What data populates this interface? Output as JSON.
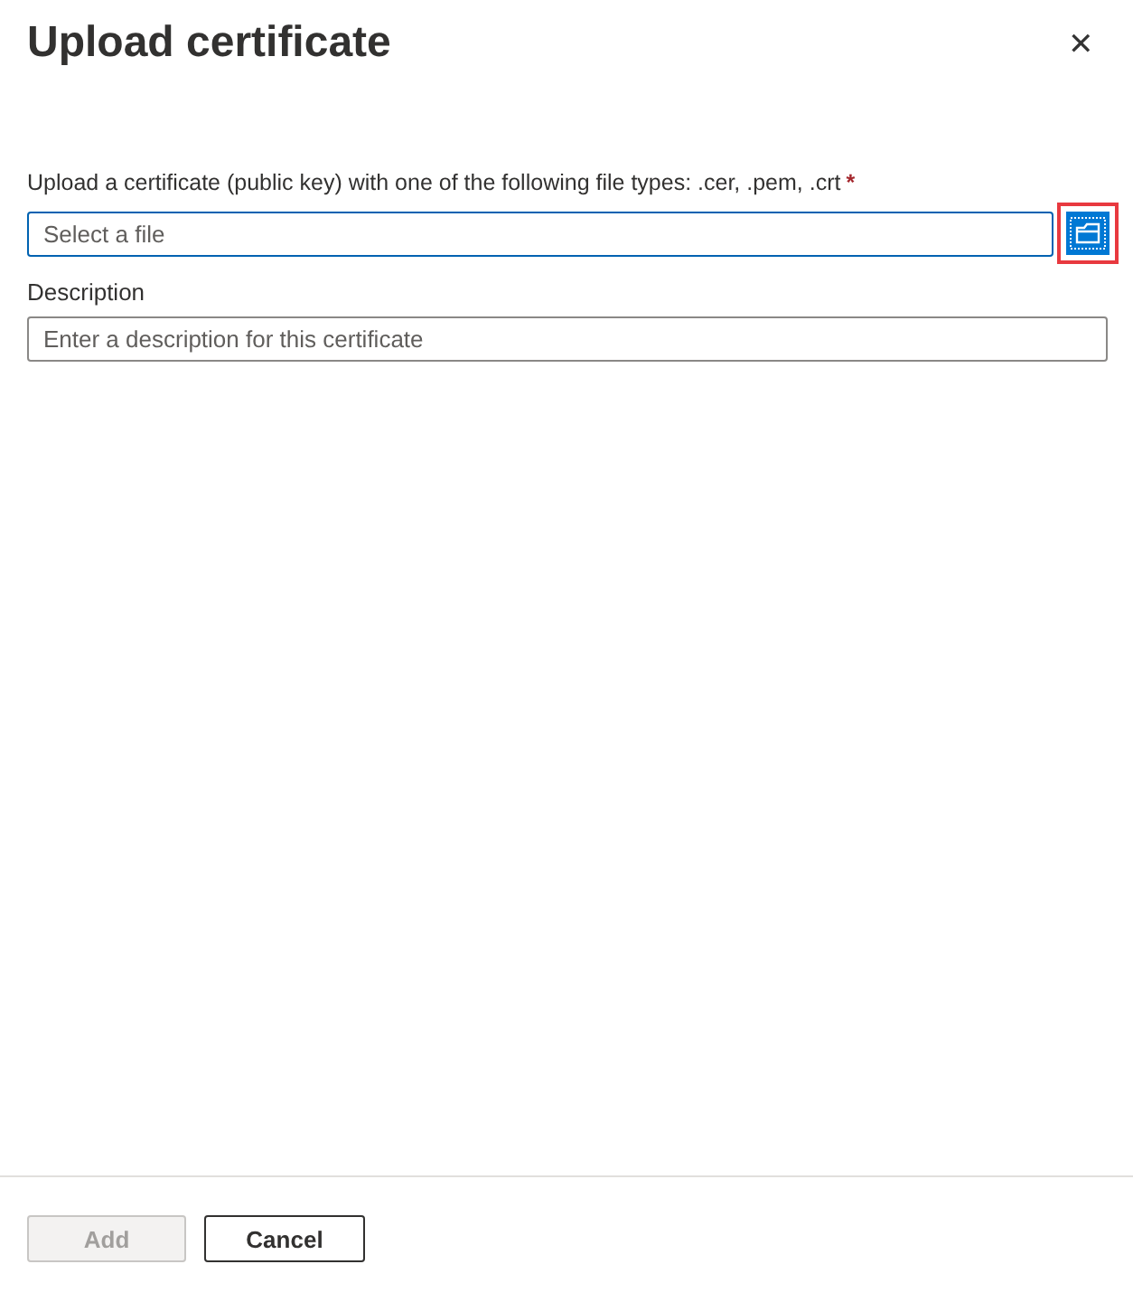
{
  "panel": {
    "title": "Upload certificate",
    "close": "✕"
  },
  "file_field": {
    "label": "Upload a certificate (public key) with one of the following file types: .cer, .pem, .crt",
    "required_mark": "*",
    "placeholder": "Select a file",
    "browse_highlighted": true
  },
  "description_field": {
    "label": "Description",
    "placeholder": "Enter a description for this certificate"
  },
  "buttons": [
    {
      "label": "Add",
      "kind": "primary",
      "disabled": true
    },
    {
      "label": "Cancel",
      "kind": "secondary",
      "disabled": false
    }
  ]
}
